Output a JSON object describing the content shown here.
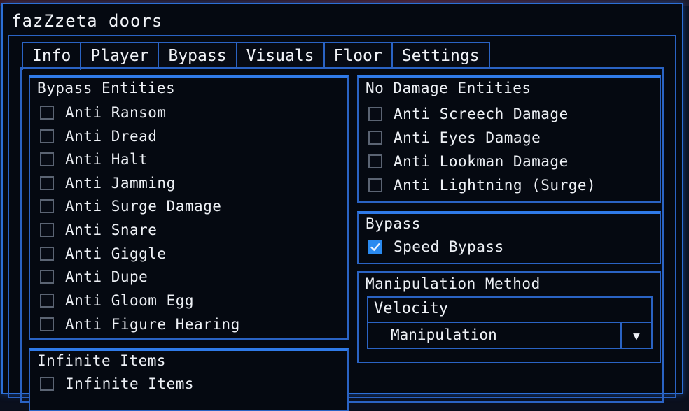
{
  "window": {
    "title": "fazZzeta doors"
  },
  "tabs": [
    {
      "label": "Info"
    },
    {
      "label": "Player"
    },
    {
      "label": "Bypass"
    },
    {
      "label": "Visuals"
    },
    {
      "label": "Floor"
    },
    {
      "label": "Settings"
    }
  ],
  "bypass_entities": {
    "title": "Bypass Entities",
    "items": [
      {
        "label": "Anti Ransom",
        "checked": false
      },
      {
        "label": "Anti Dread",
        "checked": false
      },
      {
        "label": "Anti Halt",
        "checked": false
      },
      {
        "label": "Anti Jamming",
        "checked": false
      },
      {
        "label": "Anti Surge Damage",
        "checked": false
      },
      {
        "label": "Anti Snare",
        "checked": false
      },
      {
        "label": "Anti Giggle",
        "checked": false
      },
      {
        "label": "Anti Dupe",
        "checked": false
      },
      {
        "label": "Anti Gloom Egg",
        "checked": false
      },
      {
        "label": "Anti Figure Hearing",
        "checked": false
      }
    ]
  },
  "infinite_items": {
    "title": "Infinite Items",
    "items": [
      {
        "label": "Infinite Items",
        "checked": false
      }
    ]
  },
  "no_damage": {
    "title": "No Damage Entities",
    "items": [
      {
        "label": "Anti Screech Damage",
        "checked": false
      },
      {
        "label": "Anti Eyes Damage",
        "checked": false
      },
      {
        "label": "Anti Lookman Damage",
        "checked": false
      },
      {
        "label": "Anti Lightning (Surge)",
        "checked": false
      }
    ]
  },
  "bypass": {
    "title": "Bypass",
    "items": [
      {
        "label": "Speed Bypass",
        "checked": true
      }
    ]
  },
  "manipulation": {
    "title": "Manipulation Method",
    "select_label": "Velocity",
    "selected_value": "Manipulation",
    "arrow": "▼"
  },
  "colors": {
    "accent": "#2a63c4",
    "check": "#2a8af0",
    "background": "#050911"
  }
}
